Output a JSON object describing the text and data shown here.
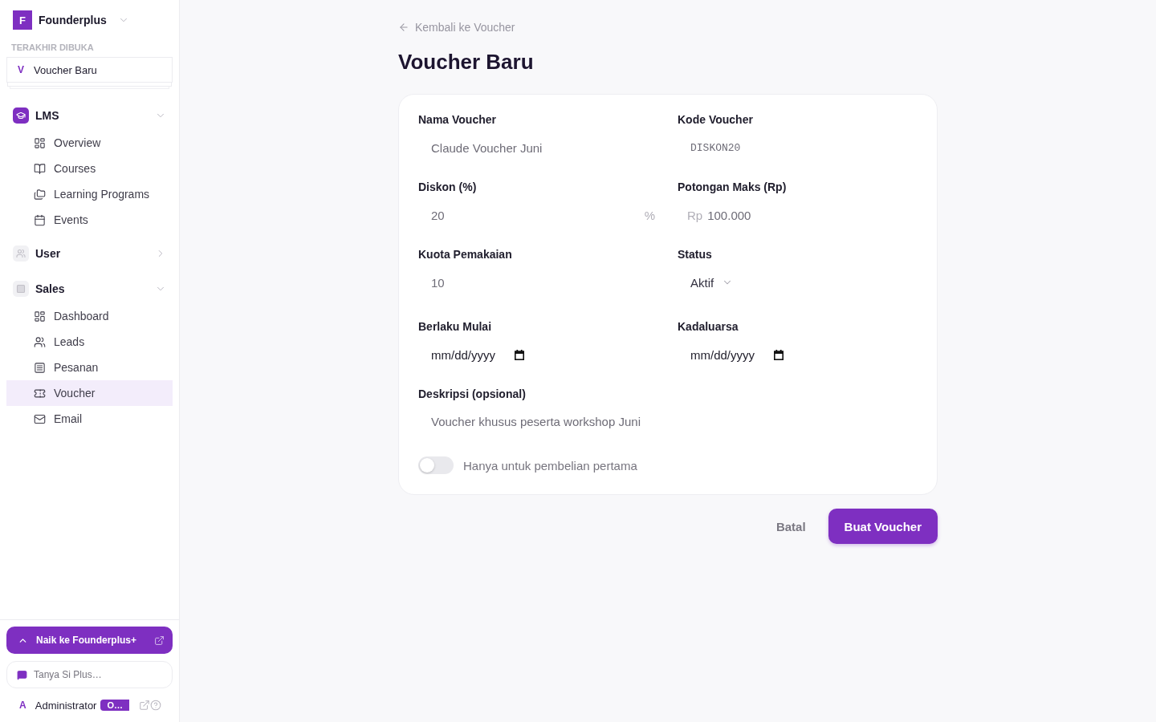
{
  "sidebar": {
    "workspace": {
      "initial": "F",
      "name": "Founderplus"
    },
    "recent": {
      "heading": "TERAKHIR DIBUKA",
      "items": [
        {
          "initial": "V",
          "label": "Voucher Baru"
        }
      ]
    },
    "groups": [
      {
        "label": "LMS",
        "color": "#7e2fc1",
        "expanded": true,
        "children": [
          {
            "label": "Overview",
            "selected": false
          },
          {
            "label": "Courses",
            "selected": false
          },
          {
            "label": "Learning Programs",
            "selected": false
          },
          {
            "label": "Events",
            "selected": false
          }
        ]
      },
      {
        "label": "User",
        "color": "#f1f1f4",
        "expanded": false
      },
      {
        "label": "Sales",
        "color": "#f1f1f4",
        "expanded": true,
        "children": [
          {
            "label": "Dashboard",
            "selected": false
          },
          {
            "label": "Leads",
            "selected": false
          },
          {
            "label": "Pesanan",
            "selected": false
          },
          {
            "label": "Voucher",
            "selected": true
          },
          {
            "label": "Email",
            "selected": false
          }
        ]
      }
    ],
    "upgrade": {
      "label": "Naik ke Founderplus+"
    },
    "assistant": {
      "label": "Tanya Si Plus…"
    },
    "user": {
      "initial": "A",
      "name": "Administrator",
      "badge": "O…"
    }
  },
  "page": {
    "back_link": "Kembali ke Voucher",
    "title": "Voucher Baru"
  },
  "form": {
    "fields": [
      {
        "kind": "text",
        "label": "Nama Voucher",
        "value": "Claude Voucher Juni"
      },
      {
        "kind": "code",
        "label": "Kode Voucher",
        "value": "DISKON20"
      },
      {
        "kind": "suffix",
        "label": "Diskon (%)",
        "value": "20",
        "suffix": "%"
      },
      {
        "kind": "prefix",
        "label": "Potongan Maks (Rp)",
        "value": "100.000",
        "prefix": "Rp"
      },
      {
        "kind": "text",
        "label": "Kuota Pemakaian",
        "value": "10"
      },
      {
        "kind": "select",
        "label": "Status",
        "value": "Aktif"
      },
      {
        "kind": "date",
        "label": "Berlaku Mulai",
        "placeholder": "mm/dd/yyyy"
      },
      {
        "kind": "date",
        "label": "Kadaluarsa",
        "placeholder": "mm/dd/yyyy"
      },
      {
        "kind": "textarea",
        "label": "Deskripsi (opsional)",
        "value": "Voucher khusus peserta workshop Juni"
      }
    ],
    "toggle": {
      "label": "Hanya untuk pembelian pertama",
      "on": false
    },
    "actions": {
      "cancel": "Batal",
      "submit": "Buat Voucher"
    }
  }
}
